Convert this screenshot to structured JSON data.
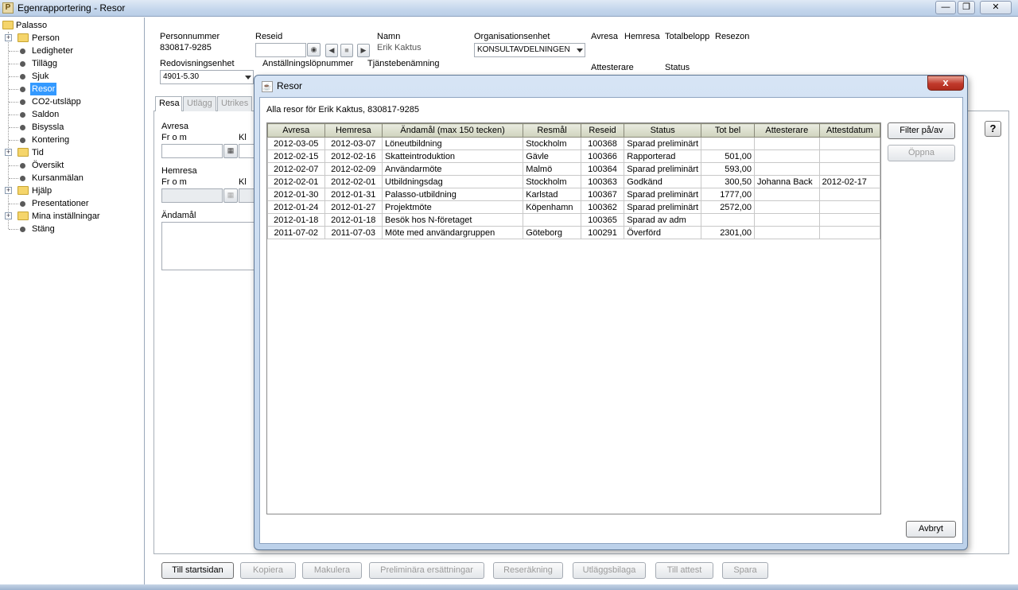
{
  "window": {
    "title": "Egenrapportering - Resor",
    "app_icon": "P"
  },
  "tree": {
    "root": "Palasso",
    "items": [
      {
        "label": "Person",
        "type": "folder",
        "expander": true
      },
      {
        "label": "Ledigheter",
        "type": "leaf"
      },
      {
        "label": "Tillägg",
        "type": "leaf"
      },
      {
        "label": "Sjuk",
        "type": "leaf"
      },
      {
        "label": "Resor",
        "type": "leaf",
        "selected": true
      },
      {
        "label": "CO2-utsläpp",
        "type": "leaf"
      },
      {
        "label": "Saldon",
        "type": "leaf"
      },
      {
        "label": "Bisyssla",
        "type": "leaf"
      },
      {
        "label": "Kontering",
        "type": "leaf"
      },
      {
        "label": "Tid",
        "type": "folder",
        "expander": true
      },
      {
        "label": "Översikt",
        "type": "leaf"
      },
      {
        "label": "Kursanmälan",
        "type": "leaf"
      },
      {
        "label": "Hjälp",
        "type": "folder",
        "expander": true
      },
      {
        "label": "Presentationer",
        "type": "leaf"
      },
      {
        "label": "Mina inställningar",
        "type": "folder",
        "expander": true
      },
      {
        "label": "Stäng",
        "type": "leaf"
      }
    ]
  },
  "form": {
    "personnummer_label": "Personnummer",
    "personnummer_value": "830817-9285",
    "reseid_label": "Reseid",
    "namn_label": "Namn",
    "namn_value": "Erik Kaktus",
    "org_label": "Organisationsenhet",
    "org_value": "KONSULTAVDELNINGEN",
    "avresa_label": "Avresa",
    "hemresa_label": "Hemresa",
    "totalbelopp_label": "Totalbelopp",
    "resezon_label": "Resezon",
    "redovisning_label": "Redovisningsenhet",
    "redovisning_value": "4901-5.30",
    "anstallning_label": "Anställningslöpnummer",
    "tjanst_label": "Tjänstebenämning",
    "attesterare_label": "Attesterare",
    "status_label": "Status"
  },
  "tabs": [
    "Resa",
    "Utlägg",
    "Utrikes"
  ],
  "panel": {
    "avresa_label": "Avresa",
    "from_label": "Fr o m",
    "kl_label": "Kl",
    "hemresa_label": "Hemresa",
    "from2_label": "Fr o m",
    "kl2_label": "Kl",
    "andamal_label": "Ändamål",
    "help_label": "?"
  },
  "bottom_buttons": [
    {
      "label": "Till startsidan",
      "enabled": true
    },
    {
      "label": "Kopiera",
      "enabled": false
    },
    {
      "label": "Makulera",
      "enabled": false
    },
    {
      "label": "Preliminära ersättningar",
      "enabled": false
    },
    {
      "label": "Reseräkning",
      "enabled": false
    },
    {
      "label": "Utläggsbilaga",
      "enabled": false
    },
    {
      "label": "Till attest",
      "enabled": false
    },
    {
      "label": "Spara",
      "enabled": false
    }
  ],
  "dialog": {
    "title": "Resor",
    "close_label": "x",
    "caption": "Alla resor för Erik Kaktus, 830817-9285",
    "columns": [
      "Avresa",
      "Hemresa",
      "Ändamål (max 150 tecken)",
      "Resmål",
      "Reseid",
      "Status",
      "Tot bel",
      "Attesterare",
      "Attestdatum"
    ],
    "rows": [
      [
        "2012-03-05",
        "2012-03-07",
        "Löneutbildning",
        "Stockholm",
        "100368",
        "Sparad preliminärt",
        "",
        "",
        ""
      ],
      [
        "2012-02-15",
        "2012-02-16",
        "Skatteintroduktion",
        "Gävle",
        "100366",
        "Rapporterad",
        "501,00",
        "",
        ""
      ],
      [
        "2012-02-07",
        "2012-02-09",
        "Användarmöte",
        "Malmö",
        "100364",
        "Sparad preliminärt",
        "593,00",
        "",
        ""
      ],
      [
        "2012-02-01",
        "2012-02-01",
        "Utbildningsdag",
        "Stockholm",
        "100363",
        "Godkänd",
        "300,50",
        "Johanna Back",
        "2012-02-17"
      ],
      [
        "2012-01-30",
        "2012-01-31",
        "Palasso-utbildning",
        "Karlstad",
        "100367",
        "Sparad preliminärt",
        "1777,00",
        "",
        ""
      ],
      [
        "2012-01-24",
        "2012-01-27",
        "Projektmöte",
        "Köpenhamn",
        "100362",
        "Sparad preliminärt",
        "2572,00",
        "",
        ""
      ],
      [
        "2012-01-18",
        "2012-01-18",
        "Besök hos N-företaget",
        "",
        "100365",
        "Sparad av adm",
        "",
        "",
        ""
      ],
      [
        "2011-07-02",
        "2011-07-03",
        "Möte med användargruppen",
        "Göteborg",
        "100291",
        "Överförd",
        "2301,00",
        "",
        ""
      ]
    ],
    "filter_label": "Filter på/av",
    "open_label": "Öppna",
    "cancel_label": "Avbryt"
  }
}
